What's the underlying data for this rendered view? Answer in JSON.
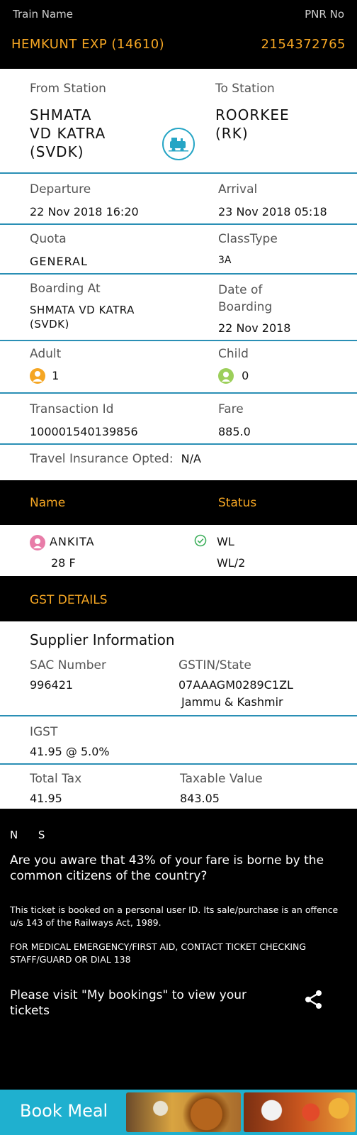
{
  "header": {
    "train_name_label": "Train Name",
    "pnr_label": "PNR No",
    "train_name": "HEMKUNT EXP (14610)",
    "pnr": "2154372765"
  },
  "journey": {
    "from_label": "From Station",
    "to_label": "To Station",
    "from_station": "SHMATA\nVD KATRA\n(SVDK)",
    "to_station": "ROORKEE\n(RK)",
    "departure_label": "Departure",
    "arrival_label": "Arrival",
    "departure": "22 Nov 2018  16:20",
    "arrival": "23 Nov 2018  05:18",
    "quota_label": "Quota",
    "class_label": "ClassType",
    "quota": "GENERAL",
    "class_type": "3A",
    "boarding_label": "Boarding At",
    "boarding_date_label": "Date of\nBoarding",
    "boarding_at": "SHMATA VD KATRA\n(SVDK)",
    "boarding_date": "22 Nov 2018",
    "adult_label": "Adult",
    "child_label": "Child",
    "adult_count": "1",
    "child_count": "0",
    "txn_label": "Transaction Id",
    "fare_label": "Fare",
    "txn_id": "100001540139856",
    "fare": "885.0",
    "insurance_label": "Travel Insurance Opted:",
    "insurance_value": "N/A"
  },
  "passengers": {
    "name_header": "Name",
    "status_header": "Status",
    "list": [
      {
        "name": "ANKITA",
        "detail": "28 F",
        "status": "WL",
        "status_detail": "WL/2"
      }
    ]
  },
  "gst": {
    "title": "GST DETAILS",
    "supplier_title": "Supplier Information",
    "sac_label": "SAC Number",
    "sac": "996421",
    "gstin_label": "GSTIN/State",
    "gstin": "07AAAGM0289C1ZL",
    "state": "Jammu & Kashmir",
    "igst_label": "IGST",
    "igst": "41.95 @ 5.0%",
    "total_tax_label": "Total Tax",
    "total_tax": "41.95",
    "taxable_label": "Taxable Value",
    "taxable": "843.05"
  },
  "notes": {
    "letters": "N      S",
    "fare_msg": "Are you aware that 43% of your fare is borne by the common citizens of the country?",
    "legal": "This ticket is booked on a personal user ID. Its sale/purchase is an offence u/s 143 of the Railways Act, 1989.",
    "medical": "FOR MEDICAL EMERGENCY/FIRST AID, CONTACT TICKET CHECKING STAFF/GUARD OR DIAL 138",
    "bookings_msg": "Please visit \"My bookings\" to view your tickets"
  },
  "book_meal": {
    "label": "Book Meal"
  },
  "colors": {
    "accent": "#f5a623",
    "divider": "#2a8fb5",
    "meal_bar": "#1fb0cf"
  },
  "icons": [
    "train-icon",
    "adult-icon",
    "child-icon",
    "female-passenger-icon",
    "check-circle-icon",
    "share-icon"
  ]
}
